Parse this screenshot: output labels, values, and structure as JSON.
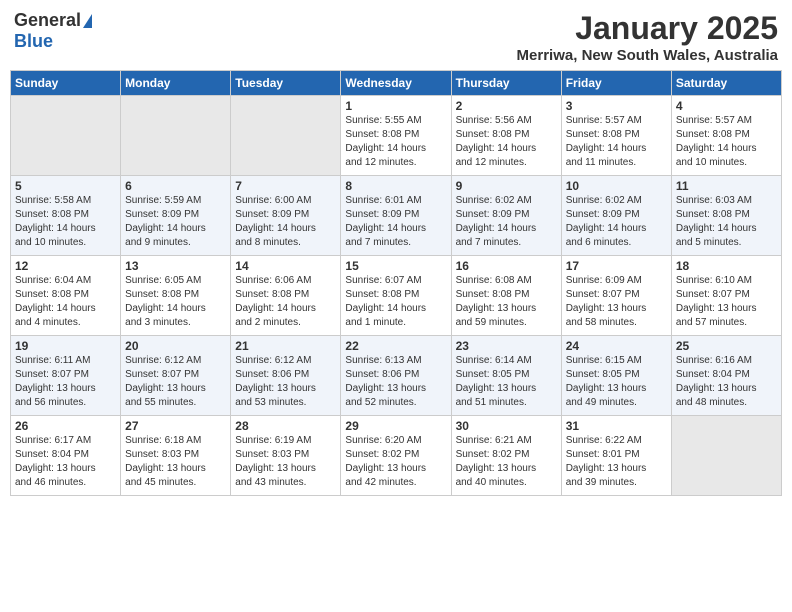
{
  "header": {
    "logo_general": "General",
    "logo_blue": "Blue",
    "month": "January 2025",
    "location": "Merriwa, New South Wales, Australia"
  },
  "weekdays": [
    "Sunday",
    "Monday",
    "Tuesday",
    "Wednesday",
    "Thursday",
    "Friday",
    "Saturday"
  ],
  "weeks": [
    [
      {
        "day": "",
        "info": ""
      },
      {
        "day": "",
        "info": ""
      },
      {
        "day": "",
        "info": ""
      },
      {
        "day": "1",
        "info": "Sunrise: 5:55 AM\nSunset: 8:08 PM\nDaylight: 14 hours\nand 12 minutes."
      },
      {
        "day": "2",
        "info": "Sunrise: 5:56 AM\nSunset: 8:08 PM\nDaylight: 14 hours\nand 12 minutes."
      },
      {
        "day": "3",
        "info": "Sunrise: 5:57 AM\nSunset: 8:08 PM\nDaylight: 14 hours\nand 11 minutes."
      },
      {
        "day": "4",
        "info": "Sunrise: 5:57 AM\nSunset: 8:08 PM\nDaylight: 14 hours\nand 10 minutes."
      }
    ],
    [
      {
        "day": "5",
        "info": "Sunrise: 5:58 AM\nSunset: 8:08 PM\nDaylight: 14 hours\nand 10 minutes."
      },
      {
        "day": "6",
        "info": "Sunrise: 5:59 AM\nSunset: 8:09 PM\nDaylight: 14 hours\nand 9 minutes."
      },
      {
        "day": "7",
        "info": "Sunrise: 6:00 AM\nSunset: 8:09 PM\nDaylight: 14 hours\nand 8 minutes."
      },
      {
        "day": "8",
        "info": "Sunrise: 6:01 AM\nSunset: 8:09 PM\nDaylight: 14 hours\nand 7 minutes."
      },
      {
        "day": "9",
        "info": "Sunrise: 6:02 AM\nSunset: 8:09 PM\nDaylight: 14 hours\nand 7 minutes."
      },
      {
        "day": "10",
        "info": "Sunrise: 6:02 AM\nSunset: 8:09 PM\nDaylight: 14 hours\nand 6 minutes."
      },
      {
        "day": "11",
        "info": "Sunrise: 6:03 AM\nSunset: 8:08 PM\nDaylight: 14 hours\nand 5 minutes."
      }
    ],
    [
      {
        "day": "12",
        "info": "Sunrise: 6:04 AM\nSunset: 8:08 PM\nDaylight: 14 hours\nand 4 minutes."
      },
      {
        "day": "13",
        "info": "Sunrise: 6:05 AM\nSunset: 8:08 PM\nDaylight: 14 hours\nand 3 minutes."
      },
      {
        "day": "14",
        "info": "Sunrise: 6:06 AM\nSunset: 8:08 PM\nDaylight: 14 hours\nand 2 minutes."
      },
      {
        "day": "15",
        "info": "Sunrise: 6:07 AM\nSunset: 8:08 PM\nDaylight: 14 hours\nand 1 minute."
      },
      {
        "day": "16",
        "info": "Sunrise: 6:08 AM\nSunset: 8:08 PM\nDaylight: 13 hours\nand 59 minutes."
      },
      {
        "day": "17",
        "info": "Sunrise: 6:09 AM\nSunset: 8:07 PM\nDaylight: 13 hours\nand 58 minutes."
      },
      {
        "day": "18",
        "info": "Sunrise: 6:10 AM\nSunset: 8:07 PM\nDaylight: 13 hours\nand 57 minutes."
      }
    ],
    [
      {
        "day": "19",
        "info": "Sunrise: 6:11 AM\nSunset: 8:07 PM\nDaylight: 13 hours\nand 56 minutes."
      },
      {
        "day": "20",
        "info": "Sunrise: 6:12 AM\nSunset: 8:07 PM\nDaylight: 13 hours\nand 55 minutes."
      },
      {
        "day": "21",
        "info": "Sunrise: 6:12 AM\nSunset: 8:06 PM\nDaylight: 13 hours\nand 53 minutes."
      },
      {
        "day": "22",
        "info": "Sunrise: 6:13 AM\nSunset: 8:06 PM\nDaylight: 13 hours\nand 52 minutes."
      },
      {
        "day": "23",
        "info": "Sunrise: 6:14 AM\nSunset: 8:05 PM\nDaylight: 13 hours\nand 51 minutes."
      },
      {
        "day": "24",
        "info": "Sunrise: 6:15 AM\nSunset: 8:05 PM\nDaylight: 13 hours\nand 49 minutes."
      },
      {
        "day": "25",
        "info": "Sunrise: 6:16 AM\nSunset: 8:04 PM\nDaylight: 13 hours\nand 48 minutes."
      }
    ],
    [
      {
        "day": "26",
        "info": "Sunrise: 6:17 AM\nSunset: 8:04 PM\nDaylight: 13 hours\nand 46 minutes."
      },
      {
        "day": "27",
        "info": "Sunrise: 6:18 AM\nSunset: 8:03 PM\nDaylight: 13 hours\nand 45 minutes."
      },
      {
        "day": "28",
        "info": "Sunrise: 6:19 AM\nSunset: 8:03 PM\nDaylight: 13 hours\nand 43 minutes."
      },
      {
        "day": "29",
        "info": "Sunrise: 6:20 AM\nSunset: 8:02 PM\nDaylight: 13 hours\nand 42 minutes."
      },
      {
        "day": "30",
        "info": "Sunrise: 6:21 AM\nSunset: 8:02 PM\nDaylight: 13 hours\nand 40 minutes."
      },
      {
        "day": "31",
        "info": "Sunrise: 6:22 AM\nSunset: 8:01 PM\nDaylight: 13 hours\nand 39 minutes."
      },
      {
        "day": "",
        "info": ""
      }
    ]
  ]
}
